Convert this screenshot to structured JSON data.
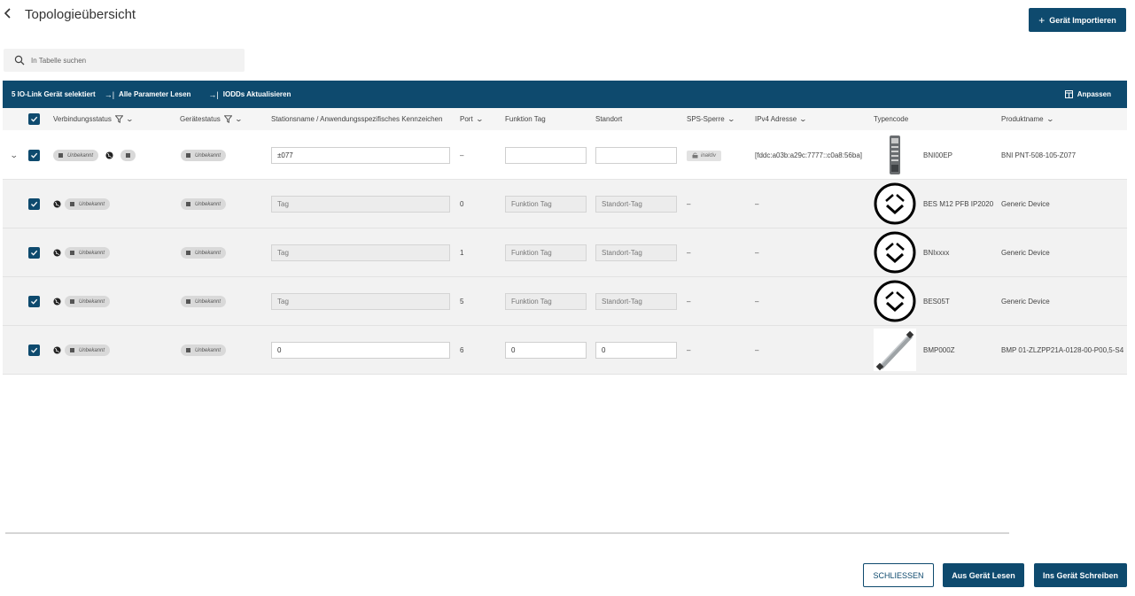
{
  "header": {
    "back_icon": "chevron-left-icon",
    "title": "Topologieübersicht",
    "import_label": "Gerät Importieren"
  },
  "search": {
    "placeholder": "In Tabelle suchen"
  },
  "toolbar": {
    "selection_text": "5 IO-Link Gerät selektiert",
    "read_all_label": "Alle Parameter Lesen",
    "update_iodd_label": "IODDs Aktualisieren",
    "customize_label": "Anpassen"
  },
  "columns": {
    "connection_status": "Verbindungsstatus",
    "device_status": "Gerätestatus",
    "station_name": "Stationsname / Anwendungsspezifisches Kennzeichen",
    "port": "Port",
    "function_tag": "Funktion Tag",
    "location": "Standort",
    "plc_lock": "SPS-Sperre",
    "ipv4": "IPv4 Adresse",
    "type_code": "Typencode",
    "product_name": "Produktname"
  },
  "rows": [
    {
      "kind": "parent",
      "checked": true,
      "expanded": true,
      "connection_status": "Unbekannt",
      "device_status": "Unbekannt",
      "station_name": "±077",
      "station_placeholder": "",
      "port": "–",
      "function_tag": "",
      "function_placeholder": "",
      "location": "",
      "location_placeholder": "",
      "plc_lock": "inaktiv",
      "ipv4": "[fddc:a03b:a29c:7777::c0a8:56ba]",
      "image": "master-module",
      "type_code": "BNI00EP",
      "product_name": "BNI PNT-508-105-Z077"
    },
    {
      "kind": "child",
      "checked": true,
      "connection_status": "Unbekannt",
      "device_status": "Unbekannt",
      "station_name": "",
      "station_placeholder": "Tag",
      "port": "0",
      "function_tag": "",
      "function_placeholder": "Funktion Tag",
      "location": "",
      "location_placeholder": "Standort-Tag",
      "plc_lock": "–",
      "ipv4": "–",
      "image": "generic-io-link-icon",
      "type_code": "BES M12 PFB IP2020",
      "product_name": "Generic Device"
    },
    {
      "kind": "child",
      "checked": true,
      "connection_status": "Unbekannt",
      "device_status": "Unbekannt",
      "station_name": "",
      "station_placeholder": "Tag",
      "port": "1",
      "function_tag": "",
      "function_placeholder": "Funktion Tag",
      "location": "",
      "location_placeholder": "Standort-Tag",
      "plc_lock": "–",
      "ipv4": "–",
      "image": "generic-io-link-icon",
      "type_code": "BNIxxxx",
      "product_name": "Generic Device"
    },
    {
      "kind": "child",
      "checked": true,
      "connection_status": "Unbekannt",
      "device_status": "Unbekannt",
      "station_name": "",
      "station_placeholder": "Tag",
      "port": "5",
      "function_tag": "",
      "function_placeholder": "Funktion Tag",
      "location": "",
      "location_placeholder": "Standort-Tag",
      "plc_lock": "–",
      "ipv4": "–",
      "image": "generic-io-link-icon",
      "type_code": "BES05T",
      "product_name": "Generic Device"
    },
    {
      "kind": "child",
      "checked": true,
      "connection_status": "Unbekannt",
      "device_status": "Unbekannt",
      "station_name": "0",
      "station_placeholder": "",
      "port": "6",
      "function_tag": "0",
      "function_placeholder": "",
      "location": "0",
      "location_placeholder": "",
      "plc_lock": "–",
      "ipv4": "–",
      "image": "linear-sensor",
      "type_code": "BMP000Z",
      "product_name": "BMP 01-ZLZPP21A-0128-00-P00,5-S4"
    }
  ],
  "footer": {
    "close_label": "SCHLIESSEN",
    "read_label": "Aus Gerät Lesen",
    "write_label": "Ins Gerät Schreiben"
  },
  "colors": {
    "primary": "#0e4a6e",
    "row_alt": "#f2f2f2",
    "pill": "#d9d9d9"
  }
}
